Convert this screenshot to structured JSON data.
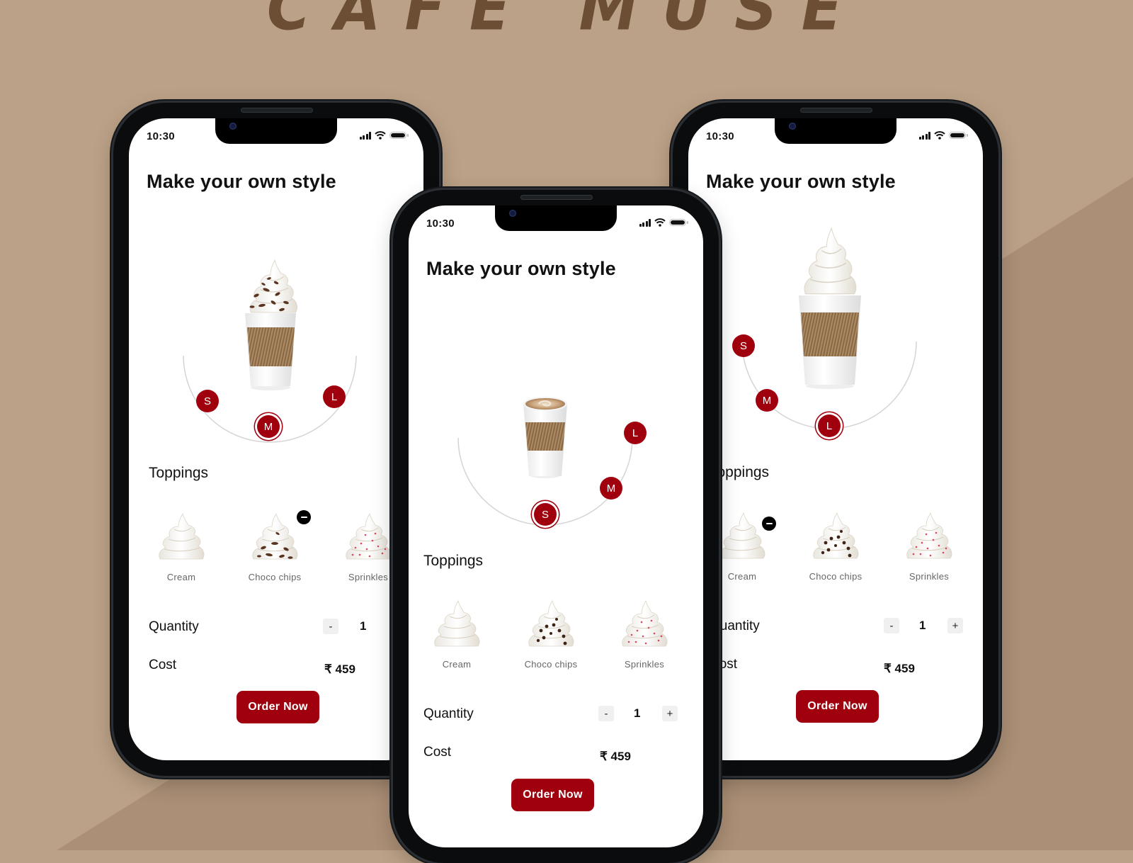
{
  "brand": {
    "title": "CAFE MUSE"
  },
  "colors": {
    "background_light": "#bba187",
    "background_dark": "#ab8f76",
    "title_brown": "#6b4e34",
    "accent": "#a0000d",
    "phone_frame": "#0b0c0d"
  },
  "phones": [
    {
      "status_time": "10:30",
      "title": "Make your own style",
      "drink": "choco-chips-coffee",
      "sizes": [
        {
          "label": "S",
          "selected": false
        },
        {
          "label": "M",
          "selected": true
        },
        {
          "label": "L",
          "selected": false
        }
      ],
      "toppings_label": "Toppings",
      "toppings": [
        {
          "label": "Cream",
          "selected": false
        },
        {
          "label": "Choco chips",
          "selected": true
        },
        {
          "label": "Sprinkles",
          "selected": false
        }
      ],
      "quantity_label": "Quantity",
      "quantity": "1",
      "decrement": "-",
      "increment": "+",
      "cost_label": "Cost",
      "cost": "₹ 459",
      "order_label": "Order Now"
    },
    {
      "status_time": "10:30",
      "title": "Make your own style",
      "drink": "latte",
      "sizes": [
        {
          "label": "S",
          "selected": true
        },
        {
          "label": "M",
          "selected": false
        },
        {
          "label": "L",
          "selected": false
        }
      ],
      "toppings_label": "Toppings",
      "toppings": [
        {
          "label": "Cream",
          "selected": false
        },
        {
          "label": "Choco chips",
          "selected": false
        },
        {
          "label": "Sprinkles",
          "selected": false
        }
      ],
      "quantity_label": "Quantity",
      "quantity": "1",
      "decrement": "-",
      "increment": "+",
      "cost_label": "Cost",
      "cost": "₹ 459",
      "order_label": "Order Now"
    },
    {
      "status_time": "10:30",
      "title": "Make your own style",
      "drink": "cream-coffee",
      "sizes": [
        {
          "label": "S",
          "selected": false
        },
        {
          "label": "M",
          "selected": false
        },
        {
          "label": "L",
          "selected": true
        }
      ],
      "toppings_label": "Toppings",
      "toppings": [
        {
          "label": "Cream",
          "selected": true
        },
        {
          "label": "Choco chips",
          "selected": false
        },
        {
          "label": "Sprinkles",
          "selected": false
        }
      ],
      "quantity_label": "Quantity",
      "quantity": "1",
      "decrement": "-",
      "increment": "+",
      "cost_label": "Cost",
      "cost": "₹ 459",
      "order_label": "Order Now"
    }
  ]
}
